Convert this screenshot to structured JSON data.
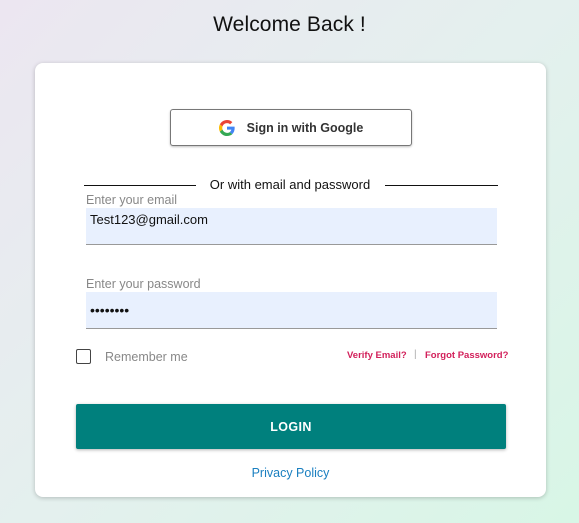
{
  "page": {
    "title": "Welcome Back !"
  },
  "google_button": {
    "label": "Sign in with Google",
    "icon": "google-logo-icon"
  },
  "divider": {
    "text": "Or with email and password"
  },
  "email": {
    "label": "Enter your email",
    "value": "Test123@gmail.com"
  },
  "password": {
    "label": "Enter your password",
    "value": "••••••••"
  },
  "remember": {
    "label": "Remember me",
    "checked": false
  },
  "links": {
    "verify": "Verify Email?",
    "separator": "|",
    "forgot": "Forgot Password?"
  },
  "login_button": {
    "label": "LOGIN"
  },
  "footer": {
    "privacy": "Privacy Policy"
  },
  "colors": {
    "accent": "#00807d",
    "link": "#d21f5a",
    "privacy_link": "#1a7fc0",
    "input_bg": "#e8f0fe"
  }
}
